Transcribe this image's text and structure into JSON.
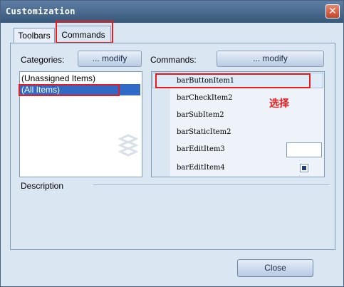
{
  "window": {
    "title": "Customization",
    "close_glyph": "✕"
  },
  "tabs": [
    {
      "label": "Toolbars"
    },
    {
      "label": "Commands"
    }
  ],
  "categories": {
    "label": "Categories:",
    "modify_label": "... modify",
    "items": [
      "(Unassigned Items)",
      "(All Items)"
    ],
    "selected": "(All Items)"
  },
  "commands": {
    "label": "Commands:",
    "modify_label": "... modify",
    "items": [
      "barButtonItem1",
      "barCheckItem2",
      "barSubItem2",
      "barStaticItem2",
      "barEditItem3",
      "barEditItem4"
    ],
    "selected": "barButtonItem1",
    "annotation": "选择"
  },
  "description": {
    "label": "Description"
  },
  "footer": {
    "close_label": "Close"
  },
  "colors": {
    "highlight_red": "#e81c1c",
    "selection_blue": "#3169c6",
    "accent_blue": "#375879"
  }
}
